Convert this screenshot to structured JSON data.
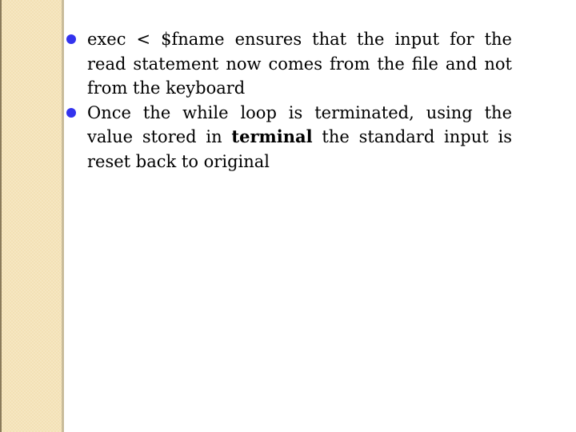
{
  "colors": {
    "bullet": "#3333ee",
    "sidebar": "#f3e1b5"
  },
  "bullets": [
    {
      "icon": "bullet-dot-icon",
      "text_before": " exec < $fname ensures that the input for the read statement now comes from the file and not from the keyboard",
      "bold": "",
      "text_after": ""
    },
    {
      "icon": "bullet-dot-icon",
      "text_before": " Once the while loop is terminated, using the value stored in ",
      "bold": "terminal",
      "text_after": " the standard input is reset back to original"
    }
  ]
}
